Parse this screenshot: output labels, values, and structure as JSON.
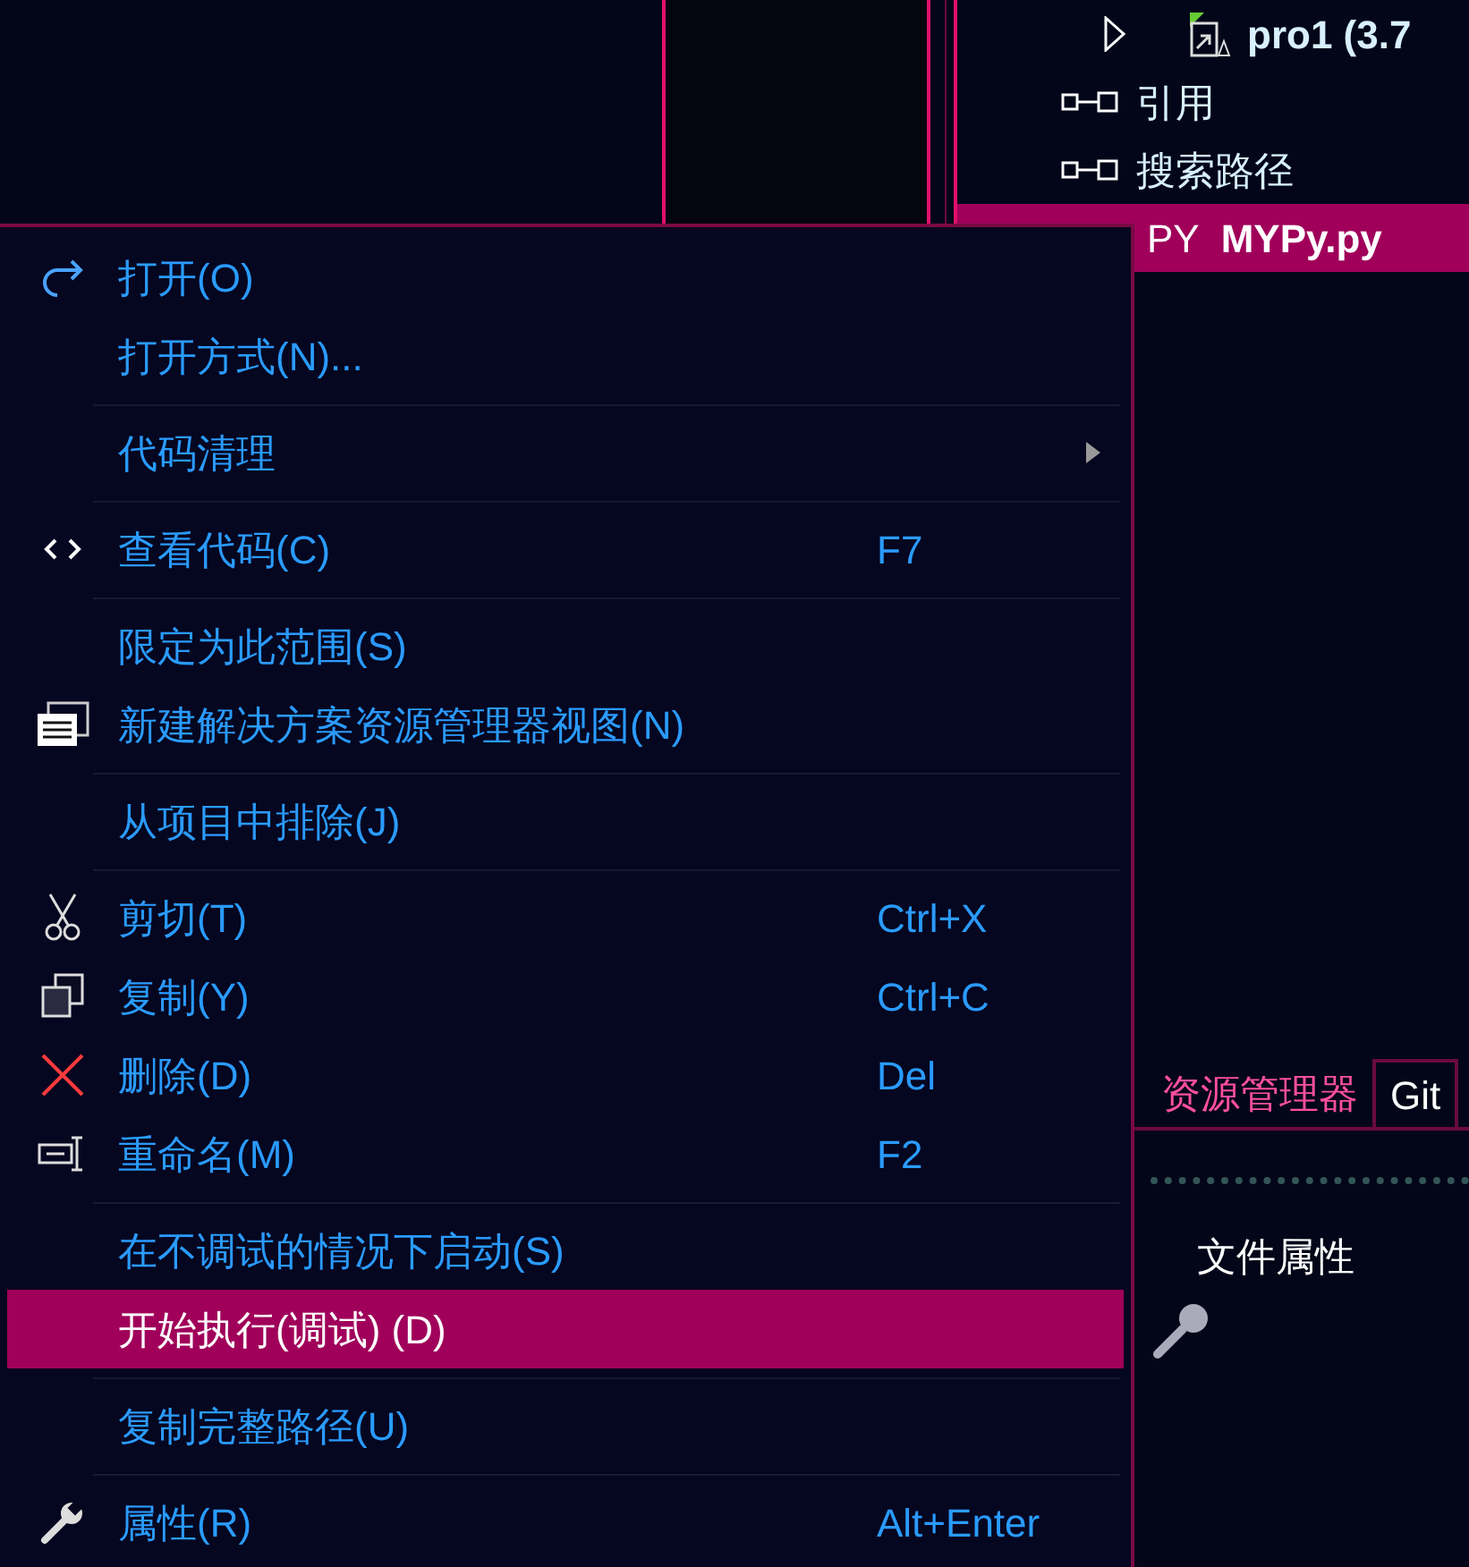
{
  "solution_tree": [
    {
      "label": "pro1 (3.7",
      "selected": false,
      "expanded": false
    },
    {
      "label": "引用",
      "selected": false
    },
    {
      "label": "搜索路径",
      "selected": false
    },
    {
      "label": "MYPy.py",
      "badge": "PY",
      "selected": true
    }
  ],
  "bottom_tabs": [
    {
      "label": "资源管理器",
      "selected": true
    },
    {
      "label": "Git",
      "selected": false
    }
  ],
  "properties": {
    "file_caption": "文件属性"
  },
  "context_menu": [
    {
      "kind": "item",
      "label": "打开(O)",
      "selected": false
    },
    {
      "kind": "item",
      "label": "打开方式(N)...",
      "selected": false
    },
    {
      "kind": "separator"
    },
    {
      "kind": "item",
      "label": "代码清理",
      "has_submenu": true,
      "selected": false
    },
    {
      "kind": "separator"
    },
    {
      "kind": "item",
      "label": "查看代码(C)",
      "shortcut": "F7",
      "selected": false
    },
    {
      "kind": "separator"
    },
    {
      "kind": "item",
      "label": "限定为此范围(S)",
      "selected": false
    },
    {
      "kind": "item",
      "label": "新建解决方案资源管理器视图(N)",
      "selected": false
    },
    {
      "kind": "separator"
    },
    {
      "kind": "item",
      "label": "从项目中排除(J)",
      "selected": false
    },
    {
      "kind": "separator"
    },
    {
      "kind": "item",
      "label": "剪切(T)",
      "shortcut": "Ctrl+X",
      "selected": false
    },
    {
      "kind": "item",
      "label": "复制(Y)",
      "shortcut": "Ctrl+C",
      "selected": false
    },
    {
      "kind": "item",
      "label": "删除(D)",
      "shortcut": "Del",
      "selected": false
    },
    {
      "kind": "item",
      "label": "重命名(M)",
      "shortcut": "F2",
      "selected": false
    },
    {
      "kind": "separator"
    },
    {
      "kind": "item",
      "label": "在不调试的情况下启动(S)",
      "selected": false
    },
    {
      "kind": "item",
      "label": "开始执行(调试) (D)",
      "selected": true
    },
    {
      "kind": "separator"
    },
    {
      "kind": "item",
      "label": "复制完整路径(U)",
      "selected": false
    },
    {
      "kind": "separator"
    },
    {
      "kind": "item",
      "label": "属性(R)",
      "shortcut": "Alt+Enter",
      "selected": false
    }
  ]
}
